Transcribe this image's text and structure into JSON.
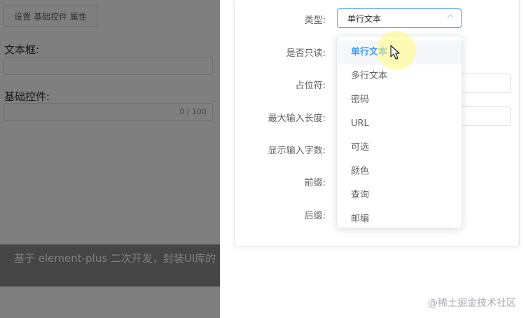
{
  "left": {
    "set_button_label": "设置 基础控件 属性",
    "textbox_label": "文本框:",
    "basic_control_label": "基础控件:",
    "counter": "0 / 100",
    "footer_text": "基于 element-plus 二次开发，封装UI库的"
  },
  "form": {
    "type_label": "类型:",
    "readonly_label": "是否只读:",
    "placeholder_label": "占位符:",
    "maxlength_label": "最大输入长度:",
    "show_count_label": "显示输入字数:",
    "prefix_label": "前缀:",
    "suffix_label": "后缀:",
    "type_value": "单行文本"
  },
  "dropdown": {
    "options": [
      "单行文本",
      "多行文本",
      "密码",
      "URL",
      "可选",
      "颜色",
      "查询",
      "邮编"
    ],
    "selected_index": 0
  },
  "colors": {
    "accent": "#409eff",
    "overlay": "#000000",
    "cursor_highlight": "#fffc78"
  },
  "watermark": "@稀土掘金技术社区"
}
